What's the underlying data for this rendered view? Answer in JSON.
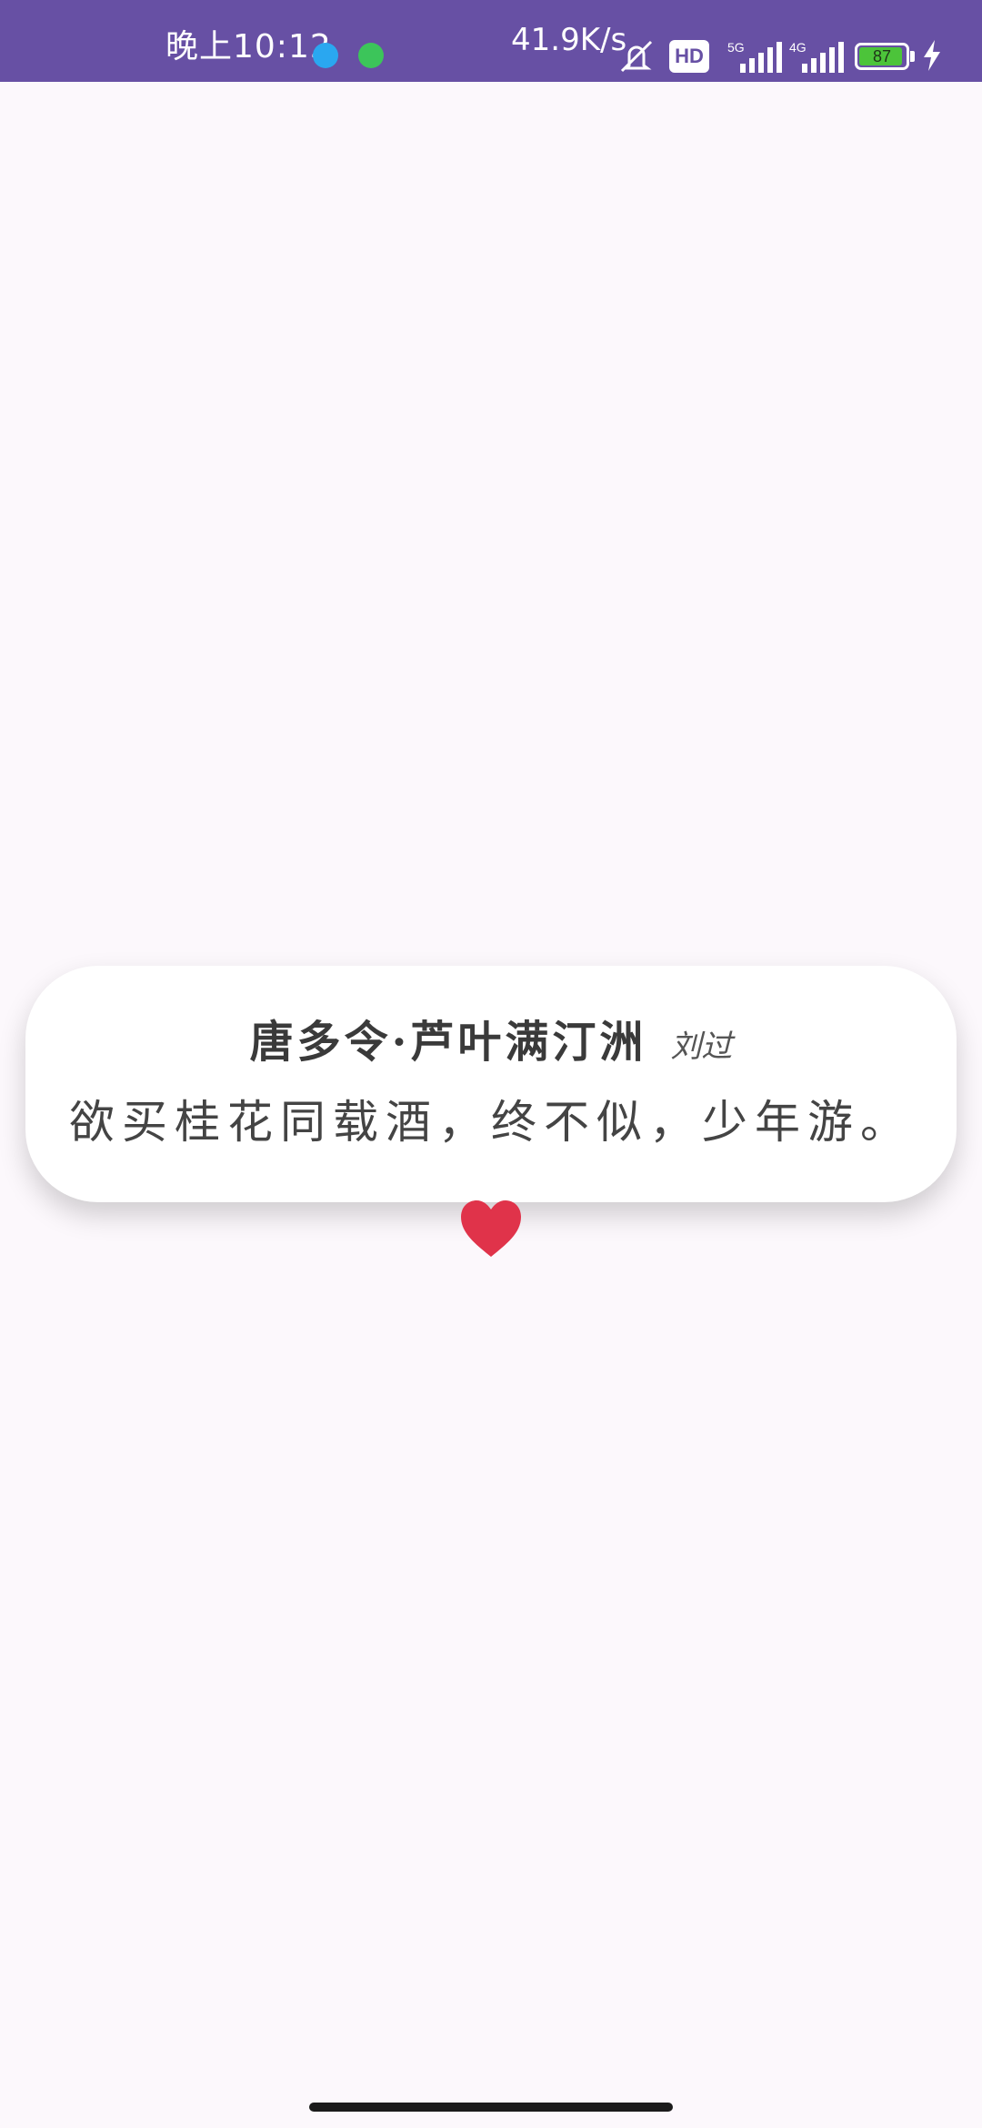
{
  "status_bar": {
    "time": "晚上10:12",
    "network_speed": "41.9K/s",
    "hd_label": "HD",
    "network_1": "5G",
    "network_2": "4G",
    "battery_level": "87",
    "battery_fraction": 0.87,
    "bar_color": "#6750a4",
    "icons": [
      "video-app-icon",
      "game-app-icon",
      "mute-icon",
      "hd-icon",
      "signal-icon",
      "signal-icon",
      "battery-icon",
      "charging-icon"
    ]
  },
  "poem": {
    "title": "唐多令·芦叶满汀洲",
    "author": "刘过",
    "line": "欲买桂花同载酒，终不似，少年游。"
  },
  "colors": {
    "background": "#fcf8fc",
    "heart": "#e0334a",
    "card": "#ffffff"
  }
}
